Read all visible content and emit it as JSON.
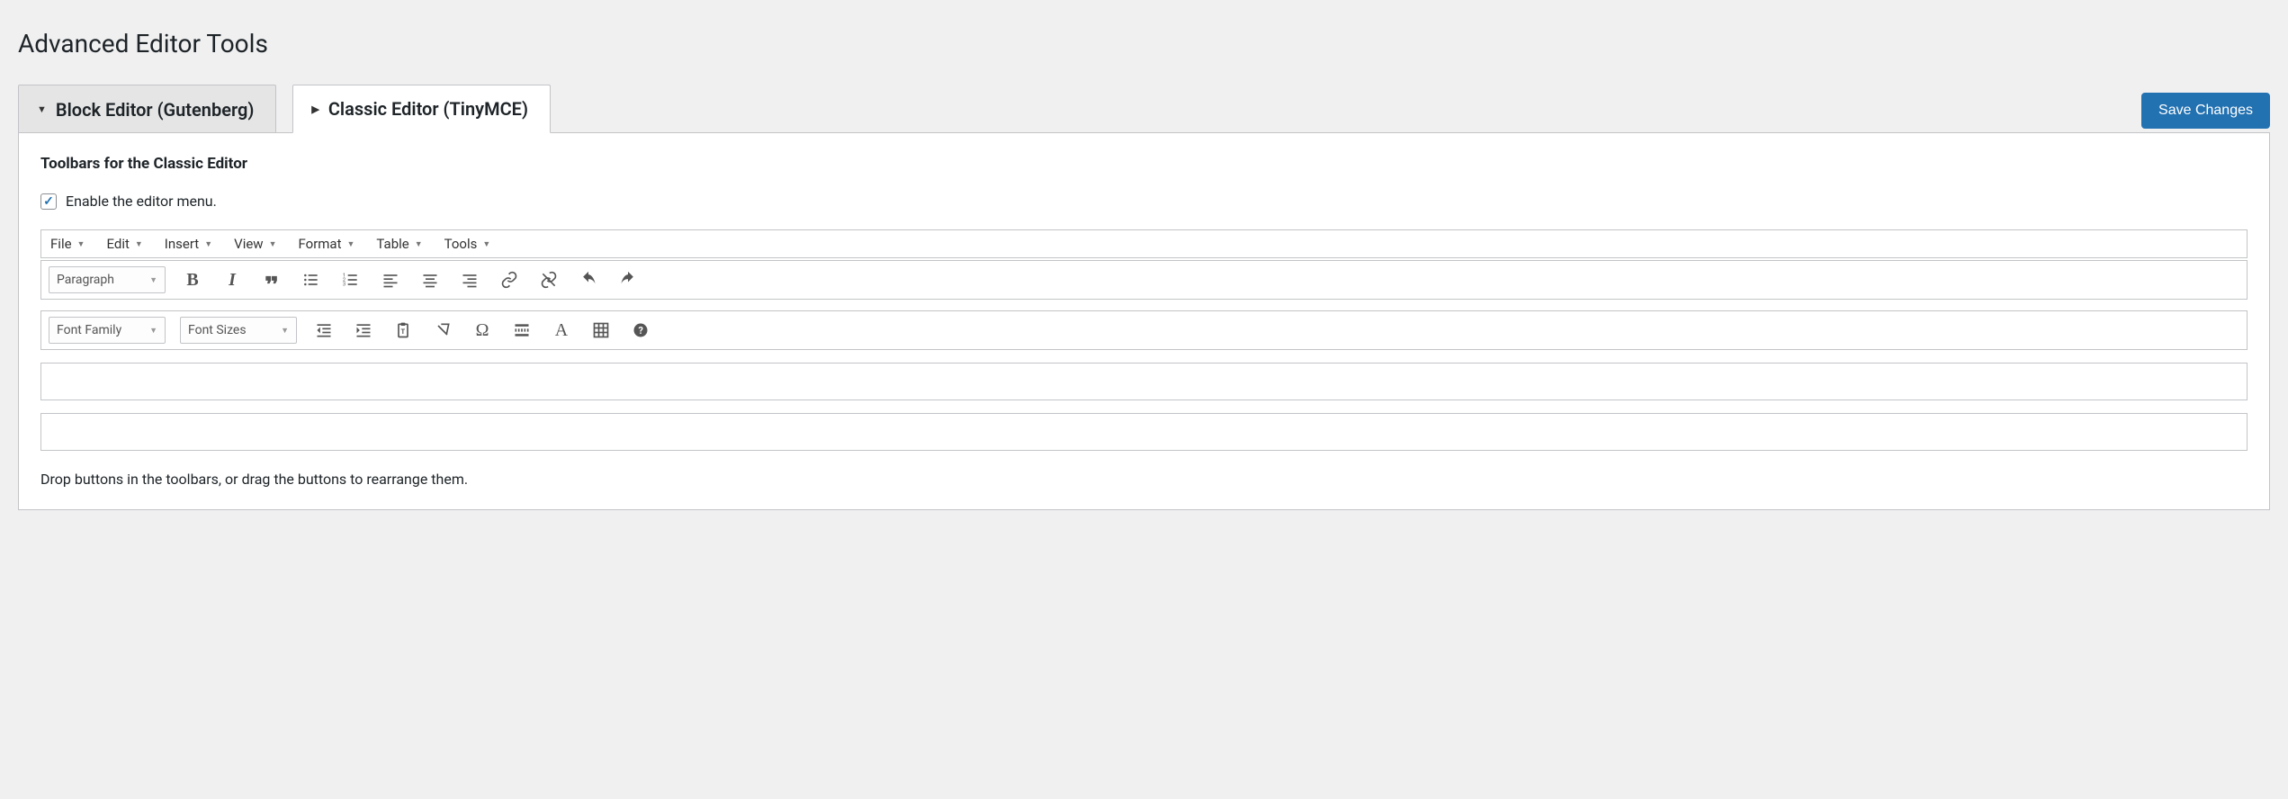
{
  "page": {
    "title": "Advanced Editor Tools",
    "save_button": "Save Changes"
  },
  "tabs": {
    "block": "Block Editor (Gutenberg)",
    "classic": "Classic Editor (TinyMCE)"
  },
  "section": {
    "title": "Toolbars for the Classic Editor",
    "enable_menu_label": "Enable the editor menu.",
    "hint": "Drop buttons in the toolbars, or drag the buttons to rearrange them."
  },
  "menubar": {
    "file": "File",
    "edit": "Edit",
    "insert": "Insert",
    "view": "View",
    "format": "Format",
    "table": "Table",
    "tools": "Tools"
  },
  "toolbar1": {
    "format_select": "Paragraph"
  },
  "toolbar2": {
    "font_family": "Font Family",
    "font_sizes": "Font Sizes"
  }
}
